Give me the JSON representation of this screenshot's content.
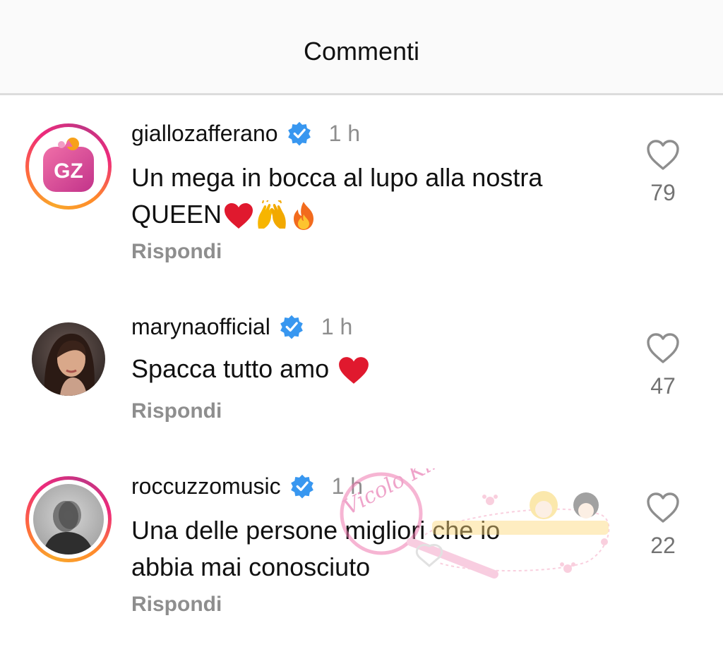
{
  "header": {
    "title": "Commenti"
  },
  "comments": [
    {
      "username": "giallozafferano",
      "verified": true,
      "time": "1 h",
      "text_line1": "Un mega in bocca al lupo alla nostra",
      "text_line2": "QUEEN",
      "emojis": [
        "red-heart-emoji",
        "raising-hands-emoji",
        "fire-emoji"
      ],
      "reply_label": "Rispondi",
      "likes": "79",
      "avatar_text": "GZ"
    },
    {
      "username": "marynaofficial",
      "verified": true,
      "time": "1 h",
      "text_line1": "Spacca tutto amo",
      "emojis": [
        "red-heart-emoji"
      ],
      "reply_label": "Rispondi",
      "likes": "47"
    },
    {
      "username": "roccuzzomusic",
      "verified": true,
      "time": "1 h",
      "text_line1": "Una delle persone migliori che io",
      "text_line2": "abbia mai conosciuto",
      "reply_label": "Rispondi",
      "likes": "22"
    }
  ],
  "colors": {
    "verified_blue": "#3897f0",
    "secondary_text": "#8e8e8e",
    "heart_red": "#e0192e",
    "story_ring": [
      "#f9a72b",
      "#ee2a7b",
      "#c13584"
    ]
  },
  "watermark": {
    "script_text": "Vicolo Kiki"
  }
}
